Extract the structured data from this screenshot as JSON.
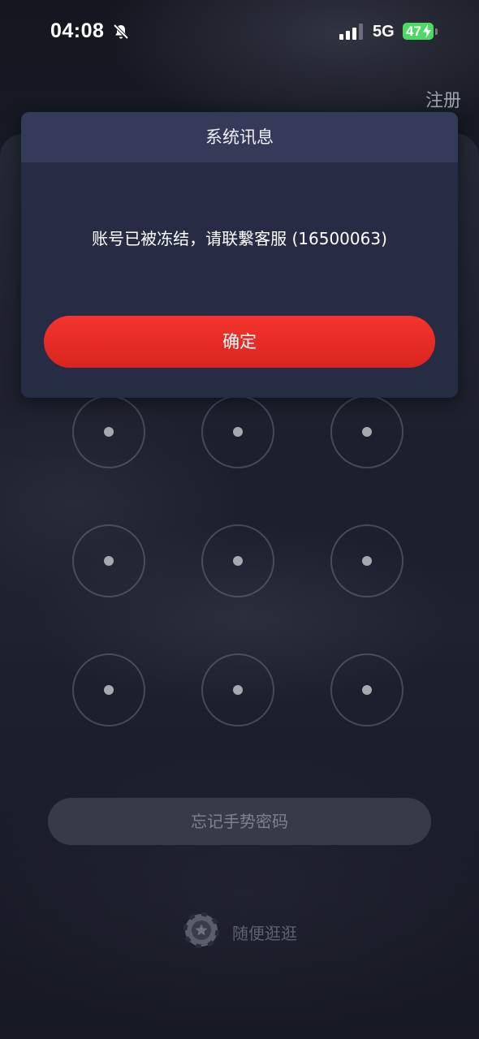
{
  "status_bar": {
    "time": "04:08",
    "network": "5G",
    "battery": "47",
    "battery_color": "#4cd964"
  },
  "header": {
    "register_label": "注册"
  },
  "dialog": {
    "title": "系统讯息",
    "message": "账号已被冻结，请联繫客服 (16500063)",
    "confirm_label": "确定",
    "confirm_color": "#e8302a"
  },
  "gesture_grid": {
    "rows": 3,
    "cols": 3
  },
  "forgot_label": "忘记手势密码",
  "browse_label": "随便逛逛",
  "icons": [
    "bell-slash-icon",
    "signal-icon",
    "battery-icon",
    "charging-bolt-icon",
    "poker-chip-icon"
  ]
}
